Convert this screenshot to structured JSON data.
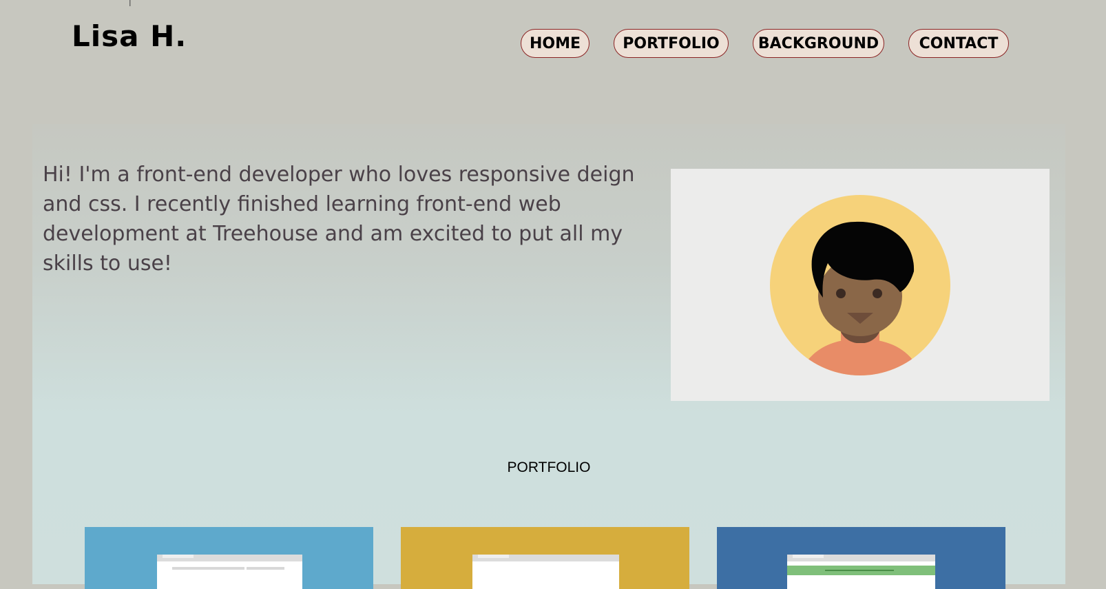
{
  "brand": {
    "name": "Lisa H."
  },
  "nav": {
    "items": [
      {
        "label": "HOME"
      },
      {
        "label": "PORTFOLIO"
      },
      {
        "label": "BACKGROUND"
      },
      {
        "label": "CONTACT"
      }
    ]
  },
  "hero": {
    "intro": "Hi! I'm a front-end developer who loves responsive deign and css. I recently finished learning front-end web development at Treehouse and am excited to put all my skills to use!",
    "avatar_icon": "person-avatar-icon"
  },
  "portfolio": {
    "title": "PORTFOLIO",
    "cards": [
      {
        "color": "#5ea9cc",
        "icon": "website-mockup-icon"
      },
      {
        "color": "#d6ad3d",
        "icon": "website-mockup-icon"
      },
      {
        "color": "#3d6fa4",
        "icon": "website-mockup-icon"
      }
    ]
  },
  "colors": {
    "page_background": "#c7c7bf",
    "nav_button_fill": "#ede0d6",
    "nav_button_border": "#8a2222",
    "avatar_circle": "#f6d27a",
    "avatar_shirt": "#e88c67"
  }
}
